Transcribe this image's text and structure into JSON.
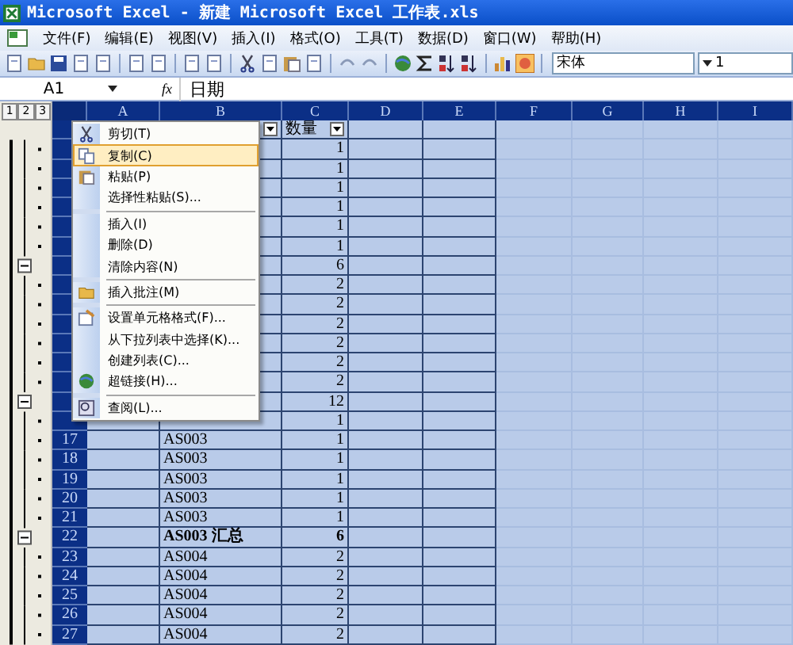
{
  "window": {
    "title": "Microsoft Excel - 新建 Microsoft Excel 工作表.xls"
  },
  "menu_bar": [
    "文件(F)",
    "编辑(E)",
    "视图(V)",
    "插入(I)",
    "格式(O)",
    "工具(T)",
    "数据(D)",
    "窗口(W)",
    "帮助(H)"
  ],
  "toolbar": {
    "font": "宋体",
    "font_size": "1"
  },
  "formula_bar": {
    "name_box": "A1",
    "fx": "fx",
    "content": "日期"
  },
  "outline_levels": [
    "1",
    "2",
    "3"
  ],
  "columns": [
    "A",
    "B",
    "C",
    "D",
    "E",
    "F",
    "G",
    "H",
    "I"
  ],
  "rows": [
    {
      "c": "数量",
      "filter_b": true,
      "filter_c": true,
      "kind": "header"
    },
    {
      "c": "1",
      "kind": "detail"
    },
    {
      "c": "1",
      "kind": "detail"
    },
    {
      "c": "1",
      "kind": "detail"
    },
    {
      "c": "1",
      "kind": "detail"
    },
    {
      "c": "1",
      "kind": "detail"
    },
    {
      "c": "1",
      "kind": "detail"
    },
    {
      "c": "6",
      "kind": "summary"
    },
    {
      "c": "2",
      "kind": "detail"
    },
    {
      "c": "2",
      "kind": "detail"
    },
    {
      "c": "2",
      "kind": "detail"
    },
    {
      "c": "2",
      "kind": "detail"
    },
    {
      "c": "2",
      "kind": "detail"
    },
    {
      "c": "2",
      "kind": "detail"
    },
    {
      "c": "12",
      "kind": "summary"
    },
    {
      "c": "1",
      "kind": "detail"
    },
    {
      "number": "17",
      "b": "AS003",
      "c": "1",
      "kind": "detail"
    },
    {
      "number": "18",
      "b": "AS003",
      "c": "1",
      "kind": "detail"
    },
    {
      "number": "19",
      "b": "AS003",
      "c": "1",
      "kind": "detail"
    },
    {
      "number": "20",
      "b": "AS003",
      "c": "1",
      "kind": "detail"
    },
    {
      "number": "21",
      "b": "AS003",
      "c": "1",
      "kind": "detail"
    },
    {
      "number": "22",
      "b": "AS003 汇总",
      "c": "6",
      "bold": true,
      "kind": "summary"
    },
    {
      "number": "23",
      "b": "AS004",
      "c": "2",
      "kind": "detail"
    },
    {
      "number": "24",
      "b": "AS004",
      "c": "2",
      "kind": "detail"
    },
    {
      "number": "25",
      "b": "AS004",
      "c": "2",
      "kind": "detail"
    },
    {
      "number": "26",
      "b": "AS004",
      "c": "2",
      "kind": "detail"
    },
    {
      "number": "27",
      "b": "AS004",
      "c": "2",
      "kind": "detail"
    }
  ],
  "context_menu": [
    {
      "kind": "item",
      "label": "剪切(T)",
      "selected": false
    },
    {
      "kind": "item",
      "label": "复制(C)",
      "selected": true
    },
    {
      "kind": "item",
      "label": "粘贴(P)",
      "selected": false
    },
    {
      "kind": "item",
      "label": "选择性粘贴(S)...",
      "selected": false
    },
    {
      "kind": "separator"
    },
    {
      "kind": "item",
      "label": "插入(I)",
      "selected": false
    },
    {
      "kind": "item",
      "label": "删除(D)",
      "selected": false
    },
    {
      "kind": "item",
      "label": "清除内容(N)",
      "selected": false
    },
    {
      "kind": "separator"
    },
    {
      "kind": "item",
      "label": "插入批注(M)",
      "selected": false
    },
    {
      "kind": "separator"
    },
    {
      "kind": "item",
      "label": "设置单元格格式(F)...",
      "selected": false
    },
    {
      "kind": "item",
      "label": "从下拉列表中选择(K)...",
      "selected": false
    },
    {
      "kind": "item",
      "label": "创建列表(C)...",
      "selected": false
    },
    {
      "kind": "item",
      "label": "超链接(H)...",
      "selected": false
    },
    {
      "kind": "separator"
    },
    {
      "kind": "item",
      "label": "查阅(L)...",
      "selected": false
    }
  ]
}
